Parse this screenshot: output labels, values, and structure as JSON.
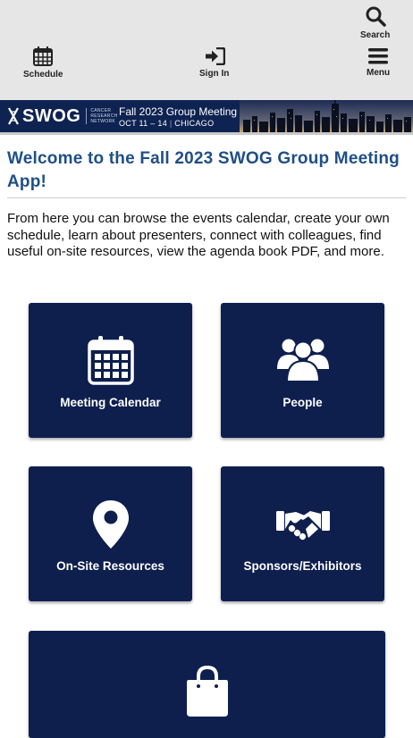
{
  "toolbar": {
    "search_label": "Search",
    "schedule_label": "Schedule",
    "signin_label": "Sign In",
    "menu_label": "Menu"
  },
  "banner": {
    "logo_text": "SWOG",
    "logo_sub_1": "CANCER",
    "logo_sub_2": "RESEARCH",
    "logo_sub_3": "NETWORK",
    "event_title": "Fall 2023 Group Meeting",
    "event_dates": "OCT 11 – 14",
    "event_city": "CHICAGO"
  },
  "welcome": {
    "title": "Welcome to the Fall 2023 SWOG Group Meeting App!",
    "intro": "From here you can browse the events calendar, create your own schedule, learn about presenters, connect with colleagues, find useful on-site resources, view the agenda book PDF, and more."
  },
  "tiles": {
    "meeting_calendar": "Meeting Calendar",
    "people": "People",
    "onsite_resources": "On-Site Resources",
    "sponsors": "Sponsors/Exhibitors"
  },
  "colors": {
    "tile_bg": "#0e1f4e",
    "heading": "#1f4f86",
    "toolbar_bg": "#e6e6e6"
  }
}
